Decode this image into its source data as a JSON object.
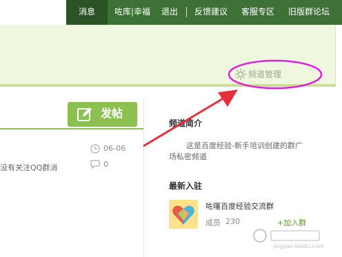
{
  "nav": {
    "items": [
      {
        "label": "消息",
        "active": true
      },
      {
        "label": "咗库|幸福"
      },
      {
        "label": "退出"
      },
      {
        "label": "反馈建议"
      },
      {
        "label": "客服专区"
      },
      {
        "label": "旧版群论坛"
      }
    ]
  },
  "banner": {
    "channel_management": "频道管理"
  },
  "main": {
    "post_button": "发帖",
    "post_snippet": "没有关注QQ群消",
    "post_date": "06-06",
    "post_replies": "0"
  },
  "sidebar": {
    "intro_title": "频道简介",
    "intro_line1": "这是百度经验-新手培训创建的群广",
    "intro_line2": "场私密频道",
    "new_title": "最新入驻",
    "group_name": "咗噻百度经验交流群",
    "member_label": "成员",
    "member_count": "230",
    "join_label": "+加入群"
  },
  "watermark": {
    "text": "jingyan.baidu.com"
  },
  "colors": {
    "nav_bg": "#3d7135",
    "banner_bg": "#eff7df",
    "accent_green": "#8cc152",
    "highlight_ellipse": "#e01ee0",
    "arrow_red": "#e8303a"
  }
}
